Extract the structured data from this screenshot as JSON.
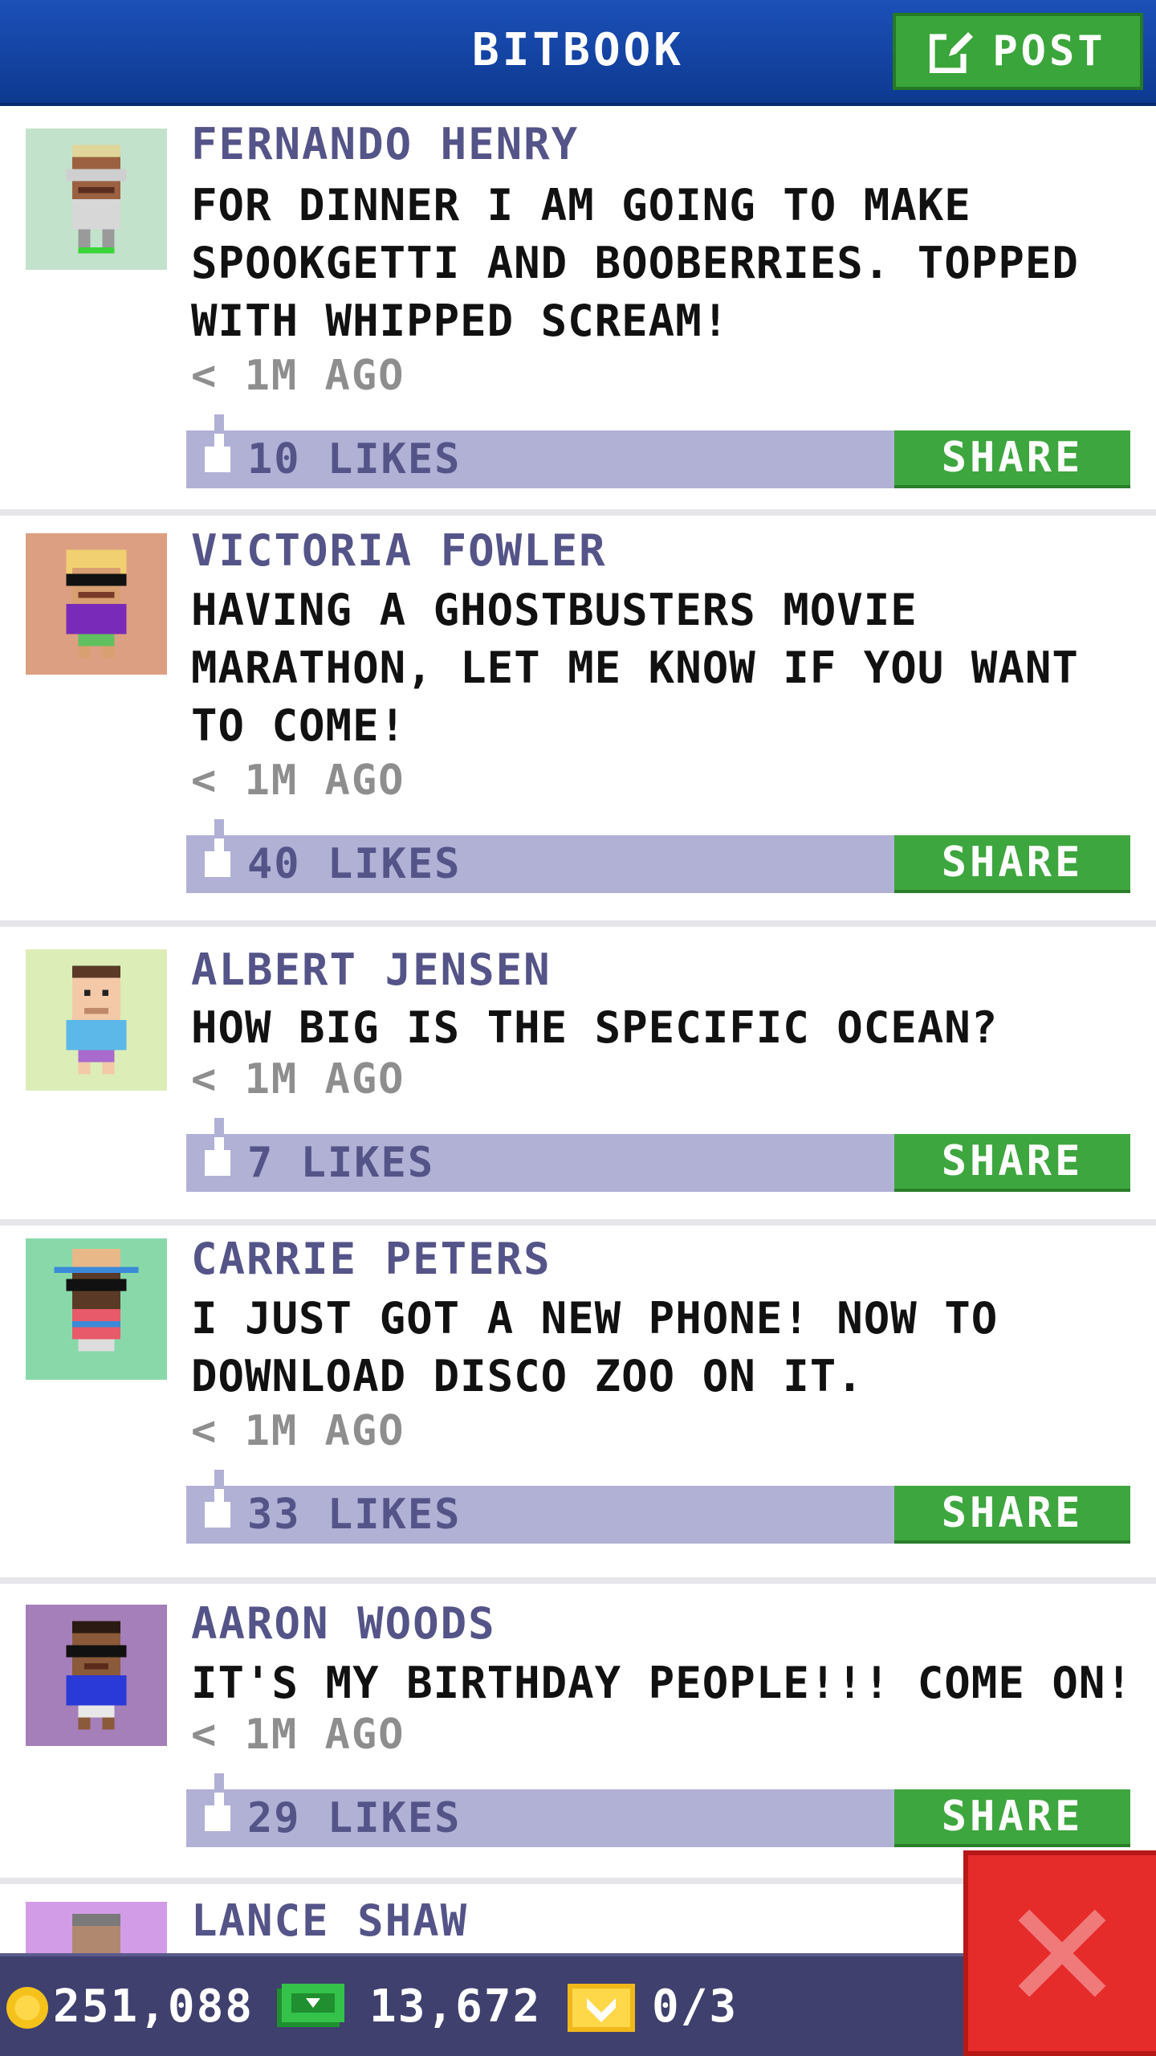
{
  "header": {
    "title": "BITBOOK",
    "post_label": "POST"
  },
  "posts": [
    {
      "name": "FERNANDO HENRY",
      "text": "FOR DINNER I AM GOING TO MAKE SPOOKGETTI AND BOOBERRIES. TOPPED WITH WHIPPED SCREAM!",
      "time": "< 1M AGO",
      "likes": "10 LIKES",
      "share_label": "SHARE",
      "avatar_bg": "#c3e2cb"
    },
    {
      "name": "VICTORIA FOWLER",
      "text": "HAVING A GHOSTBUSTERS MOVIE MARATHON, LET ME KNOW IF YOU WANT TO COME!",
      "time": "< 1M AGO",
      "likes": "40 LIKES",
      "share_label": "SHARE",
      "avatar_bg": "#dd9f82"
    },
    {
      "name": "ALBERT JENSEN",
      "text": "HOW BIG IS THE SPECIFIC OCEAN?",
      "time": "< 1M AGO",
      "likes": "7 LIKES",
      "share_label": "SHARE",
      "avatar_bg": "#dcedb8"
    },
    {
      "name": "CARRIE PETERS",
      "text": "I JUST GOT A NEW PHONE! NOW TO DOWNLOAD DISCO ZOO ON IT.",
      "time": "< 1M AGO",
      "likes": "33 LIKES",
      "share_label": "SHARE",
      "avatar_bg": "#88d8aa"
    },
    {
      "name": "AARON WOODS",
      "text": "IT'S MY BIRTHDAY PEOPLE!!! COME ON!",
      "time": "< 1M AGO",
      "likes": "29 LIKES",
      "share_label": "SHARE",
      "avatar_bg": "#a57fb9"
    },
    {
      "name": "LANCE SHAW",
      "avatar_bg": "#d29ce6"
    }
  ],
  "status": {
    "coins": "251,088",
    "bux": "13,672",
    "tickets": "0/3"
  },
  "colors": {
    "header": "#1546a8",
    "post_button": "#3aa53a",
    "like_bar": "#b1b1d6",
    "share_button": "#3ea63e",
    "close_button": "#e62b2b",
    "status_bar": "#3f406e"
  },
  "icons": {
    "post": "edit-icon",
    "like": "thumbs-up-icon",
    "close": "close-icon",
    "coin": "coin-icon",
    "bux": "bux-icon",
    "ticket": "ticket-icon"
  }
}
